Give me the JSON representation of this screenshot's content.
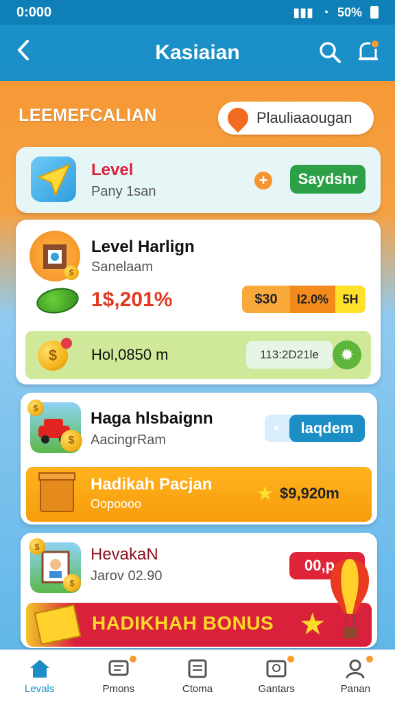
{
  "status": {
    "time": "0:000",
    "battery": "50%"
  },
  "header": {
    "title": "Kasiaian",
    "back_icon": "back-arrow-icon",
    "search_icon": "search-icon",
    "bell_icon": "bell-icon"
  },
  "section": {
    "heading": "LEEMEFCALIAN",
    "pill_label": "Plauliaaougan"
  },
  "card_level": {
    "title": "Level",
    "subtitle": "Pany 1san",
    "action_label": "Saydshr"
  },
  "card_harlign": {
    "title": "Level Harlign",
    "subtitle": "Sanelaam",
    "percent": "1$,201%",
    "chip_a": "$30",
    "chip_b": "l2.0%",
    "chip_c": "5H",
    "bar_text": "Hol,0850 m",
    "bar_chip": "113:2D21le"
  },
  "card_haga": {
    "title": "Haga hlsbaignn",
    "subtitle": "AacingrRam",
    "button_label": "laqdem",
    "banner_title": "Hadikah Pacjan",
    "banner_sub": "Oopoooo",
    "banner_amount": "$9,920m"
  },
  "card_hevakan": {
    "title": "HevakaN",
    "subtitle": "Jarov 02.90",
    "chip_label": "00,p",
    "bonus_text": "HADIKHAH BONUS"
  },
  "nav": [
    {
      "label": "Levals",
      "icon": "home-icon"
    },
    {
      "label": "Pmons",
      "icon": "chat-icon"
    },
    {
      "label": "Ctoma",
      "icon": "document-icon"
    },
    {
      "label": "Gantars",
      "icon": "image-icon"
    },
    {
      "label": "Panan",
      "icon": "profile-icon"
    }
  ],
  "colors": {
    "primary": "#1b8ec6",
    "accent": "#f79b2b",
    "green": "#2ba046",
    "red": "#d9213b"
  }
}
